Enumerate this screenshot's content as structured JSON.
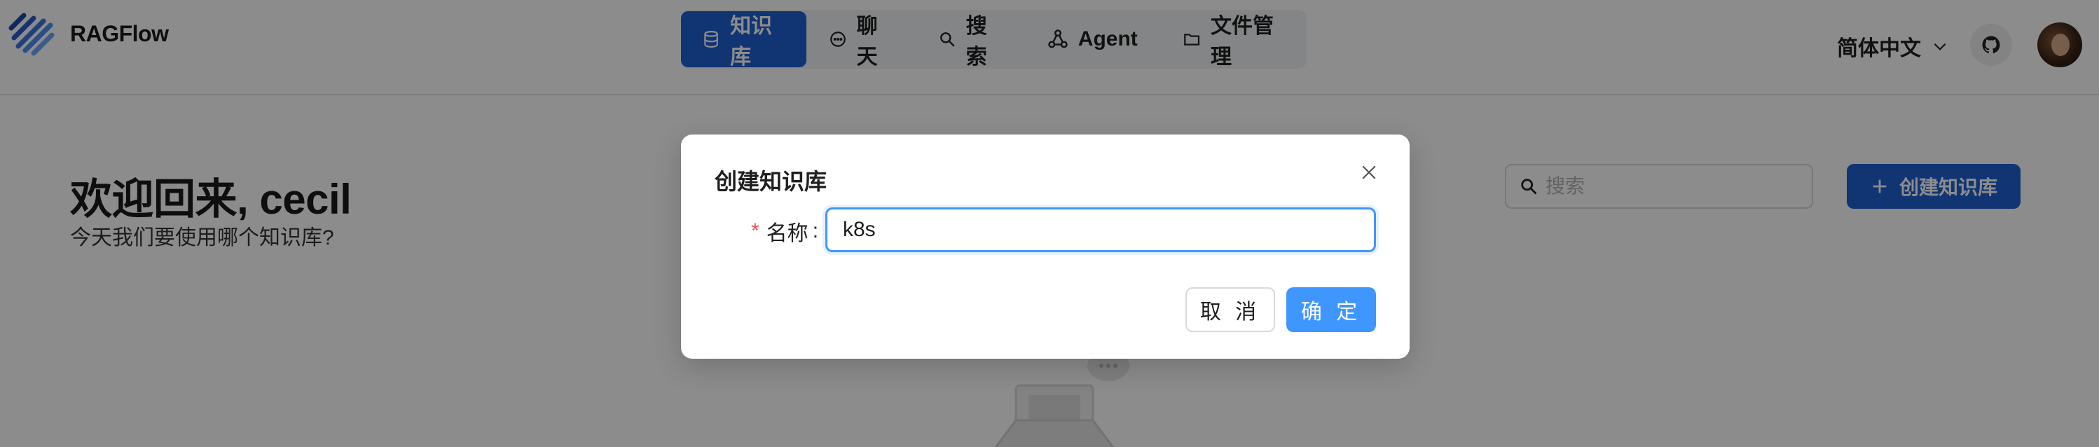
{
  "header": {
    "brand": "RAGFlow",
    "nav": [
      {
        "label": "知识库",
        "icon": "database-icon",
        "active": true
      },
      {
        "label": "聊天",
        "icon": "chat-icon",
        "active": false
      },
      {
        "label": "搜索",
        "icon": "search-icon",
        "active": false
      },
      {
        "label": "Agent",
        "icon": "agent-graph-icon",
        "active": false
      },
      {
        "label": "文件管理",
        "icon": "folder-icon",
        "active": false
      }
    ],
    "language": "简体中文",
    "github_icon": "github-icon",
    "avatar_icon": "avatar"
  },
  "main": {
    "welcome": "欢迎回来, cecil",
    "subtitle": "今天我们要使用哪个知识库?",
    "search_placeholder": "搜索",
    "create_button": "创建知识库"
  },
  "modal": {
    "title": "创建知识库",
    "name_label": "名称",
    "required_mark": "*",
    "name_value": "k8s",
    "cancel_label": "取 消",
    "ok_label": "确 定"
  },
  "colors": {
    "primary": "#1f5fd1",
    "focus_border": "#4096ff",
    "ok_button": "#4096ff",
    "required": "#ff4d4f"
  }
}
